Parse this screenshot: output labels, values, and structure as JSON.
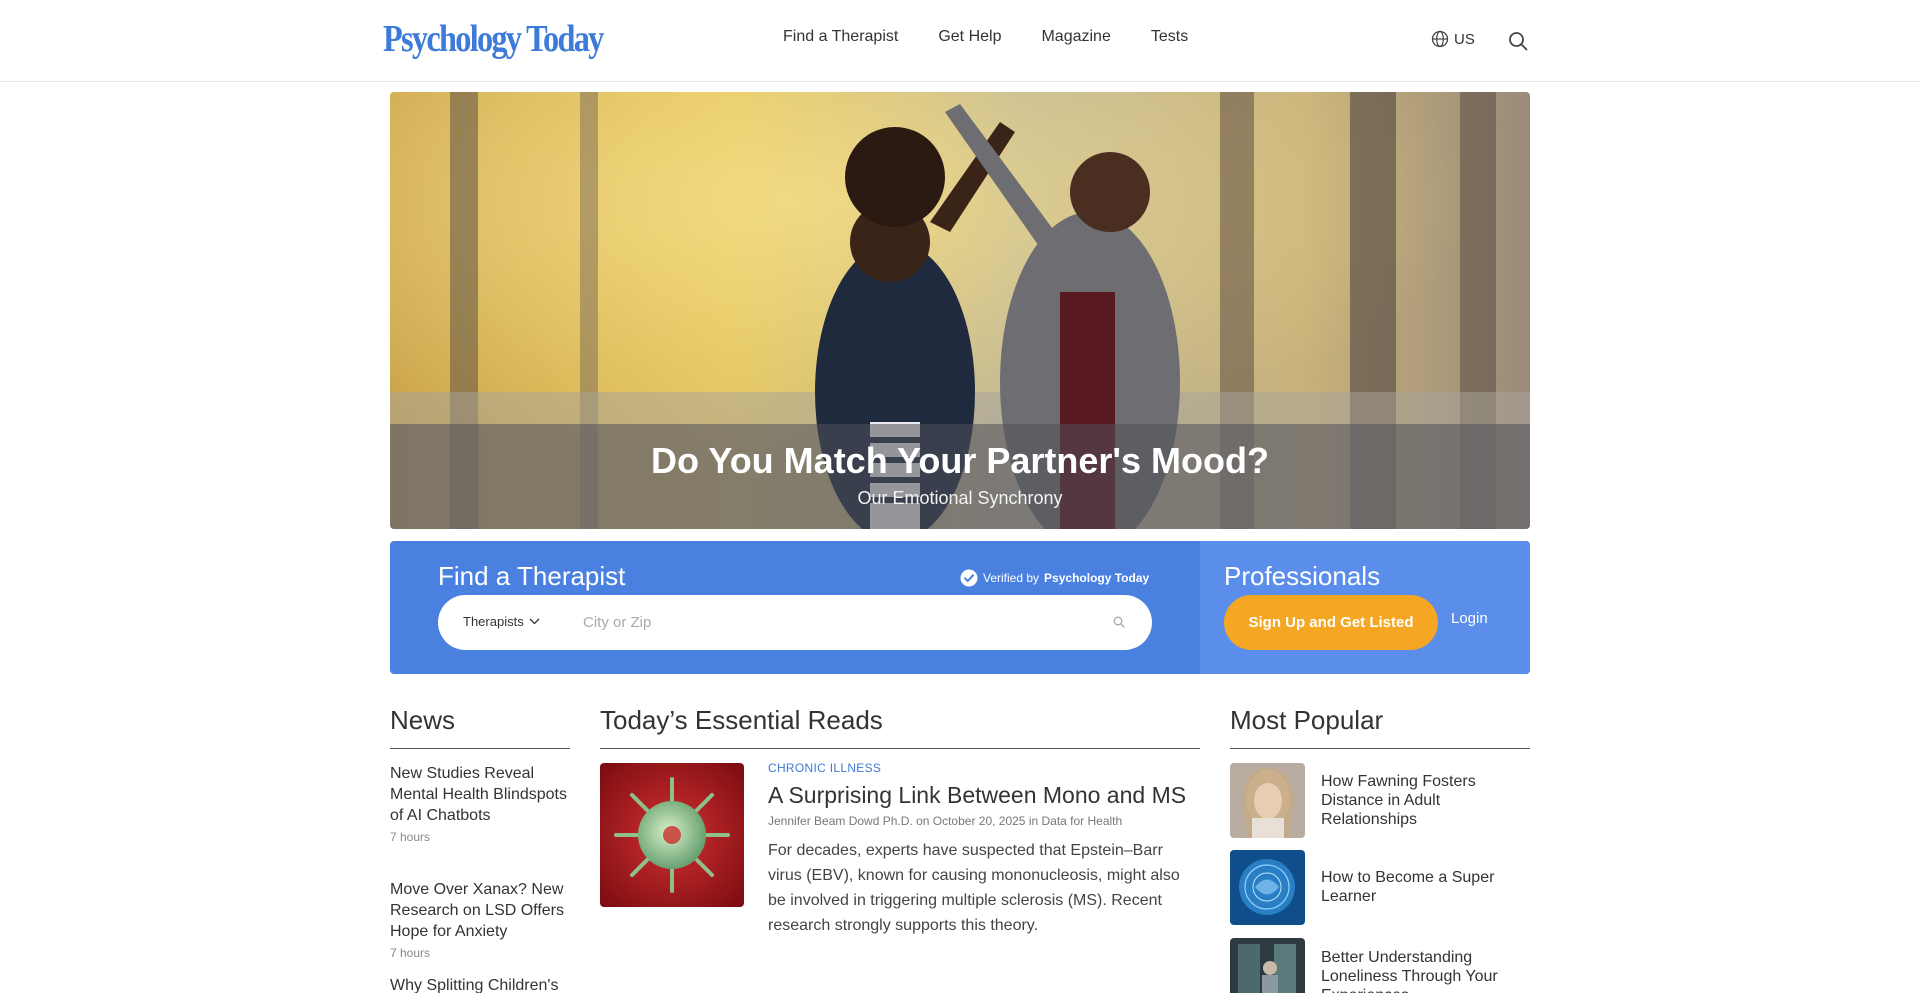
{
  "header": {
    "logo": "Psychology Today",
    "nav": [
      "Find a Therapist",
      "Get Help",
      "Magazine",
      "Tests"
    ],
    "locale": "US"
  },
  "hero": {
    "title": "Do You Match Your Partner's Mood?",
    "subtitle": "Our Emotional Synchrony"
  },
  "find": {
    "title": "Find a Therapist",
    "verified_prefix": "Verified by",
    "verified_brand": "Psychology Today",
    "select_value": "Therapists",
    "placeholder": "City or Zip"
  },
  "professionals": {
    "title": "Professionals",
    "signup": "Sign Up and Get Listed",
    "login": "Login"
  },
  "news": {
    "title": "News",
    "items": [
      {
        "title": "New Studies Reveal Mental Health Blindspots of AI Chatbots",
        "ago": "7 hours"
      },
      {
        "title": "Move Over Xanax? New Research on LSD Offers Hope for Anxiety",
        "ago": "7 hours"
      },
      {
        "title": "Why Splitting Children's",
        "ago": ""
      }
    ]
  },
  "reads": {
    "title": "Today’s Essential Reads",
    "article": {
      "category": "CHRONIC ILLNESS",
      "title": "A Surprising Link Between Mono and MS",
      "byline": "Jennifer Beam Dowd Ph.D. on October 20, 2025 in Data for Health",
      "excerpt": "For decades, experts have suspected that Epstein–Barr virus (EBV), known for causing mononucleosis, might also be involved in triggering multiple sclerosis (MS). Recent research strongly supports this theory."
    }
  },
  "popular": {
    "title": "Most Popular",
    "items": [
      {
        "title": "How Fawning Fosters Distance in Adult Relationships"
      },
      {
        "title": "How to Become a Super Learner"
      },
      {
        "title": "Better Understanding Loneliness Through Your Experiences"
      }
    ]
  },
  "colors": {
    "brand_blue": "#3d7ad9",
    "band_blue": "#4a80e0",
    "cta_orange": "#f5a623"
  }
}
